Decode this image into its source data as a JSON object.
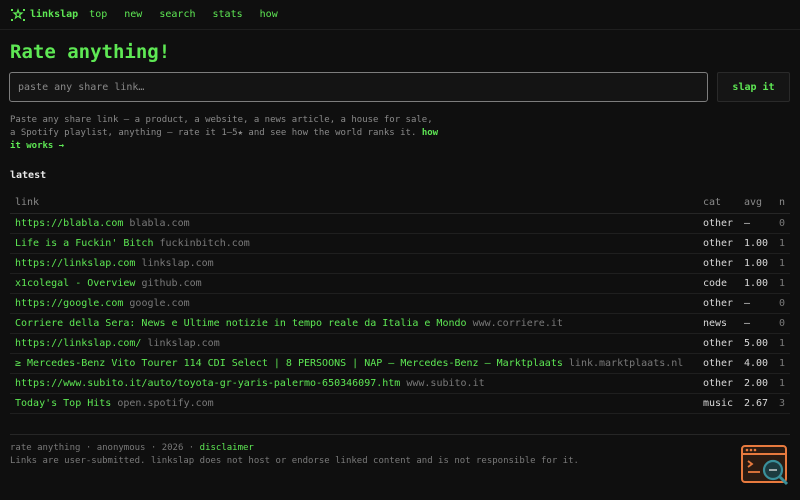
{
  "header": {
    "brand": "linkslap",
    "nav": [
      "top",
      "new",
      "search",
      "stats",
      "how"
    ]
  },
  "hero": {
    "title": "Rate anything!",
    "input_placeholder": "paste any share link…",
    "button_label": "slap it",
    "intro_text": "Paste any share link — a product, a website, a news article, a house for sale, a Spotify playlist, anything — rate it 1–5★ and see how the world ranks it.",
    "intro_link": "how it works →"
  },
  "latest": {
    "title": "latest",
    "columns": [
      "link",
      "cat",
      "avg",
      "n"
    ],
    "rows": [
      {
        "title": "https://blabla.com",
        "domain": "blabla.com",
        "cat": "other",
        "avg": "–",
        "n": "0"
      },
      {
        "title": "Life is a Fuckin' Bitch",
        "domain": "fuckinbitch.com",
        "cat": "other",
        "avg": "1.00",
        "n": "1"
      },
      {
        "title": "https://linkslap.com",
        "domain": "linkslap.com",
        "cat": "other",
        "avg": "1.00",
        "n": "1"
      },
      {
        "title": "x1colegal - Overview",
        "domain": "github.com",
        "cat": "code",
        "avg": "1.00",
        "n": "1"
      },
      {
        "title": "https://google.com",
        "domain": "google.com",
        "cat": "other",
        "avg": "–",
        "n": "0"
      },
      {
        "title": "Corriere della Sera: News e Ultime notizie in tempo reale da Italia e Mondo",
        "domain": "www.corriere.it",
        "cat": "news",
        "avg": "–",
        "n": "0"
      },
      {
        "title": "https://linkslap.com/",
        "domain": "linkslap.com",
        "cat": "other",
        "avg": "5.00",
        "n": "1"
      },
      {
        "title": "≥ Mercedes-Benz Vito Tourer 114 CDI Select | 8 PERSOONS | NAP — Mercedes-Benz — Marktplaats",
        "domain": "link.marktplaats.nl",
        "cat": "other",
        "avg": "4.00",
        "n": "1"
      },
      {
        "title": "https://www.subito.it/auto/toyota-gr-yaris-palermo-650346097.htm",
        "domain": "www.subito.it",
        "cat": "other",
        "avg": "2.00",
        "n": "1"
      },
      {
        "title": "Today's Top Hits",
        "domain": "open.spotify.com",
        "cat": "music",
        "avg": "2.67",
        "n": "3"
      }
    ]
  },
  "footer": {
    "line1_prefix": "rate anything · anonymous · 2026 ·",
    "disclaimer_link": "disclaimer",
    "line2": "Links are user-submitted. linkslap does not host or endorse linked content and is not responsible for it."
  },
  "colors": {
    "accent": "#5ee854",
    "background": "#0f0f0f",
    "widget_orange": "#e87a3e",
    "widget_teal": "#3a8f9a"
  },
  "icons": {
    "logo": "scatter-star-icon",
    "widget": "window-magnifier-icon"
  }
}
